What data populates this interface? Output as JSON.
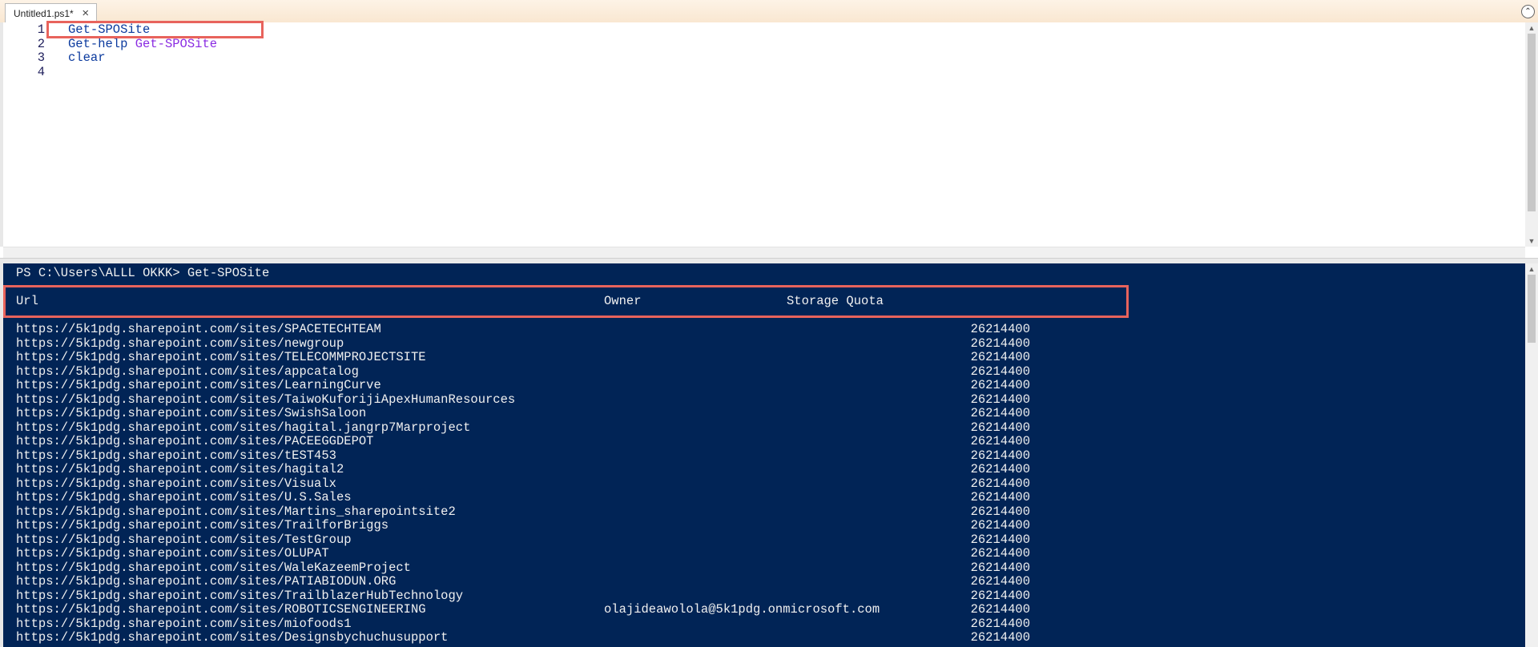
{
  "tab": {
    "title": "Untitled1.ps1*",
    "close_glyph": "×"
  },
  "collapse_glyph": "⌃",
  "editor": {
    "lines": [
      {
        "num": "1",
        "cmd": "Get-SPOSite",
        "arg": ""
      },
      {
        "num": "2",
        "cmd": "Get-help",
        "arg": "Get-SPOSite"
      },
      {
        "num": "3",
        "cmd": "clear",
        "arg": ""
      },
      {
        "num": "4",
        "cmd": "",
        "arg": ""
      }
    ]
  },
  "console": {
    "prompt": "PS C:\\Users\\ALLL OKKK> Get-SPOSite",
    "headers": {
      "url": "Url",
      "owner": "Owner",
      "quota": "Storage Quota"
    },
    "rows": [
      {
        "url": "https://5k1pdg.sharepoint.com/sites/SPACETECHTEAM",
        "owner": "",
        "quota": "26214400"
      },
      {
        "url": "https://5k1pdg.sharepoint.com/sites/newgroup",
        "owner": "",
        "quota": "26214400"
      },
      {
        "url": "https://5k1pdg.sharepoint.com/sites/TELECOMMPROJECTSITE",
        "owner": "",
        "quota": "26214400"
      },
      {
        "url": "https://5k1pdg.sharepoint.com/sites/appcatalog",
        "owner": "",
        "quota": "26214400"
      },
      {
        "url": "https://5k1pdg.sharepoint.com/sites/LearningCurve",
        "owner": "",
        "quota": "26214400"
      },
      {
        "url": "https://5k1pdg.sharepoint.com/sites/TaiwoKuforijiApexHumanResources",
        "owner": "",
        "quota": "26214400"
      },
      {
        "url": "https://5k1pdg.sharepoint.com/sites/SwishSaloon",
        "owner": "",
        "quota": "26214400"
      },
      {
        "url": "https://5k1pdg.sharepoint.com/sites/hagital.jangrp7Marproject",
        "owner": "",
        "quota": "26214400"
      },
      {
        "url": "https://5k1pdg.sharepoint.com/sites/PACEEGGDEPOT",
        "owner": "",
        "quota": "26214400"
      },
      {
        "url": "https://5k1pdg.sharepoint.com/sites/tEST453",
        "owner": "",
        "quota": "26214400"
      },
      {
        "url": "https://5k1pdg.sharepoint.com/sites/hagital2",
        "owner": "",
        "quota": "26214400"
      },
      {
        "url": "https://5k1pdg.sharepoint.com/sites/Visualx",
        "owner": "",
        "quota": "26214400"
      },
      {
        "url": "https://5k1pdg.sharepoint.com/sites/U.S.Sales",
        "owner": "",
        "quota": "26214400"
      },
      {
        "url": "https://5k1pdg.sharepoint.com/sites/Martins_sharepointsite2",
        "owner": "",
        "quota": "26214400"
      },
      {
        "url": "https://5k1pdg.sharepoint.com/sites/TrailforBriggs",
        "owner": "",
        "quota": "26214400"
      },
      {
        "url": "https://5k1pdg.sharepoint.com/sites/TestGroup",
        "owner": "",
        "quota": "26214400"
      },
      {
        "url": "https://5k1pdg.sharepoint.com/sites/OLUPAT",
        "owner": "",
        "quota": "26214400"
      },
      {
        "url": "https://5k1pdg.sharepoint.com/sites/WaleKazeemProject",
        "owner": "",
        "quota": "26214400"
      },
      {
        "url": "https://5k1pdg.sharepoint.com/sites/PATIABIODUN.ORG",
        "owner": "",
        "quota": "26214400"
      },
      {
        "url": "https://5k1pdg.sharepoint.com/sites/TrailblazerHubTechnology",
        "owner": "",
        "quota": "26214400"
      },
      {
        "url": "https://5k1pdg.sharepoint.com/sites/ROBOTICSENGINEERING",
        "owner": "olajideawolola@5k1pdg.onmicrosoft.com",
        "quota": "26214400"
      },
      {
        "url": "https://5k1pdg.sharepoint.com/sites/miofoods1",
        "owner": "",
        "quota": "26214400"
      },
      {
        "url": "https://5k1pdg.sharepoint.com/sites/Designsbychuchusupport",
        "owner": "",
        "quota": "26214400"
      }
    ]
  },
  "colors": {
    "console_bg": "#012456",
    "highlight_border": "#e8635c",
    "keyword": "#0b3a9e",
    "argument": "#8a2be2"
  }
}
